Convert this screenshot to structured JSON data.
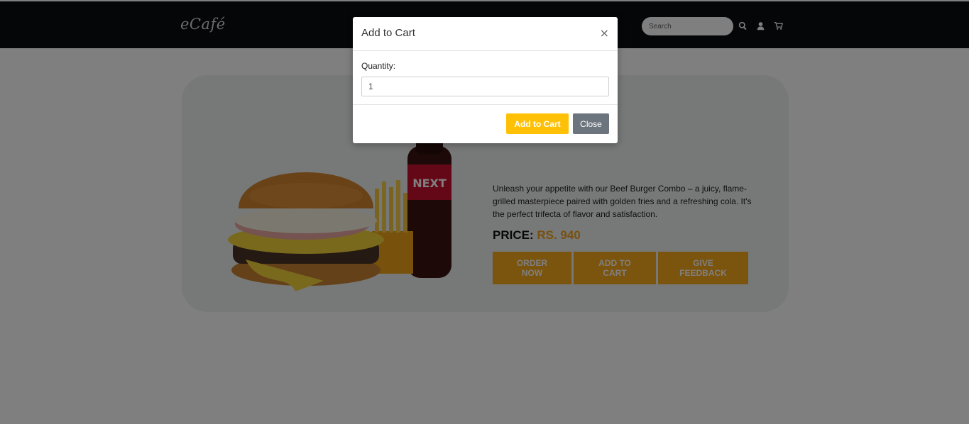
{
  "nav": {
    "logo": "eCafé",
    "search_placeholder": "Search",
    "icons": [
      "search-icon",
      "user-icon",
      "cart-icon"
    ]
  },
  "product": {
    "image": "beef-burger-combo-photo",
    "description": "Unleash your appetite with our Beef Burger Combo – a juicy, flame-grilled masterpiece paired with golden fries and a refreshing cola. It's the perfect trifecta of flavor and satisfaction.",
    "price_label": "PRICE:",
    "price_value": "RS. 940",
    "buttons": {
      "order_now": "ORDER NOW",
      "add_to_cart": "ADD TO CART",
      "give_feedback": "GIVE FEEDBACK"
    }
  },
  "modal": {
    "title": "Add to Cart",
    "close_symbol": "×",
    "quantity_label": "Quantity:",
    "quantity_value": "1",
    "add_button": "Add to Cart",
    "close_button": "Close"
  },
  "colors": {
    "accent_orange": "#f7a81b",
    "modal_add_yellow": "#ffc107",
    "close_gray": "#6c757d",
    "nav_black": "#0b0d10"
  }
}
